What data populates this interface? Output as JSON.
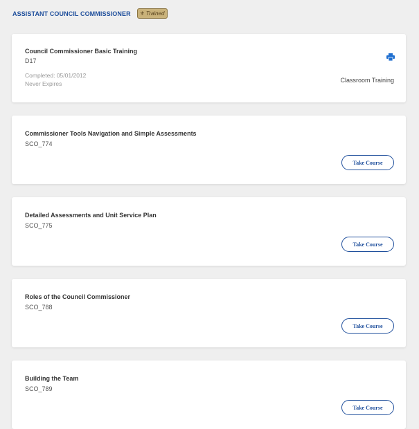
{
  "header": {
    "role_title": "ASSISTANT COUNCIL COMMISSIONER",
    "badge_icon": "fleur-de-lis-icon",
    "badge_label": "Trained"
  },
  "colors": {
    "accent": "#1f4f9c",
    "badge_bg": "#c9b27a",
    "page_bg": "#efefef"
  },
  "completed_course": {
    "title": "Council Commissioner Basic Training",
    "code": "D17",
    "completed": "Completed: 05/01/2012",
    "expiry": "Never Expires",
    "type": "Classroom Training",
    "action_icon": "print-icon"
  },
  "courses": [
    {
      "title": "Commissioner Tools Navigation and Simple Assessments",
      "code": "SCO_774",
      "button": "Take Course"
    },
    {
      "title": "Detailed Assessments and Unit Service Plan",
      "code": "SCO_775",
      "button": "Take Course"
    },
    {
      "title": "Roles of the Council Commissioner",
      "code": "SCO_788",
      "button": "Take Course"
    },
    {
      "title": "Building the Team",
      "code": "SCO_789",
      "button": "Take Course"
    }
  ]
}
